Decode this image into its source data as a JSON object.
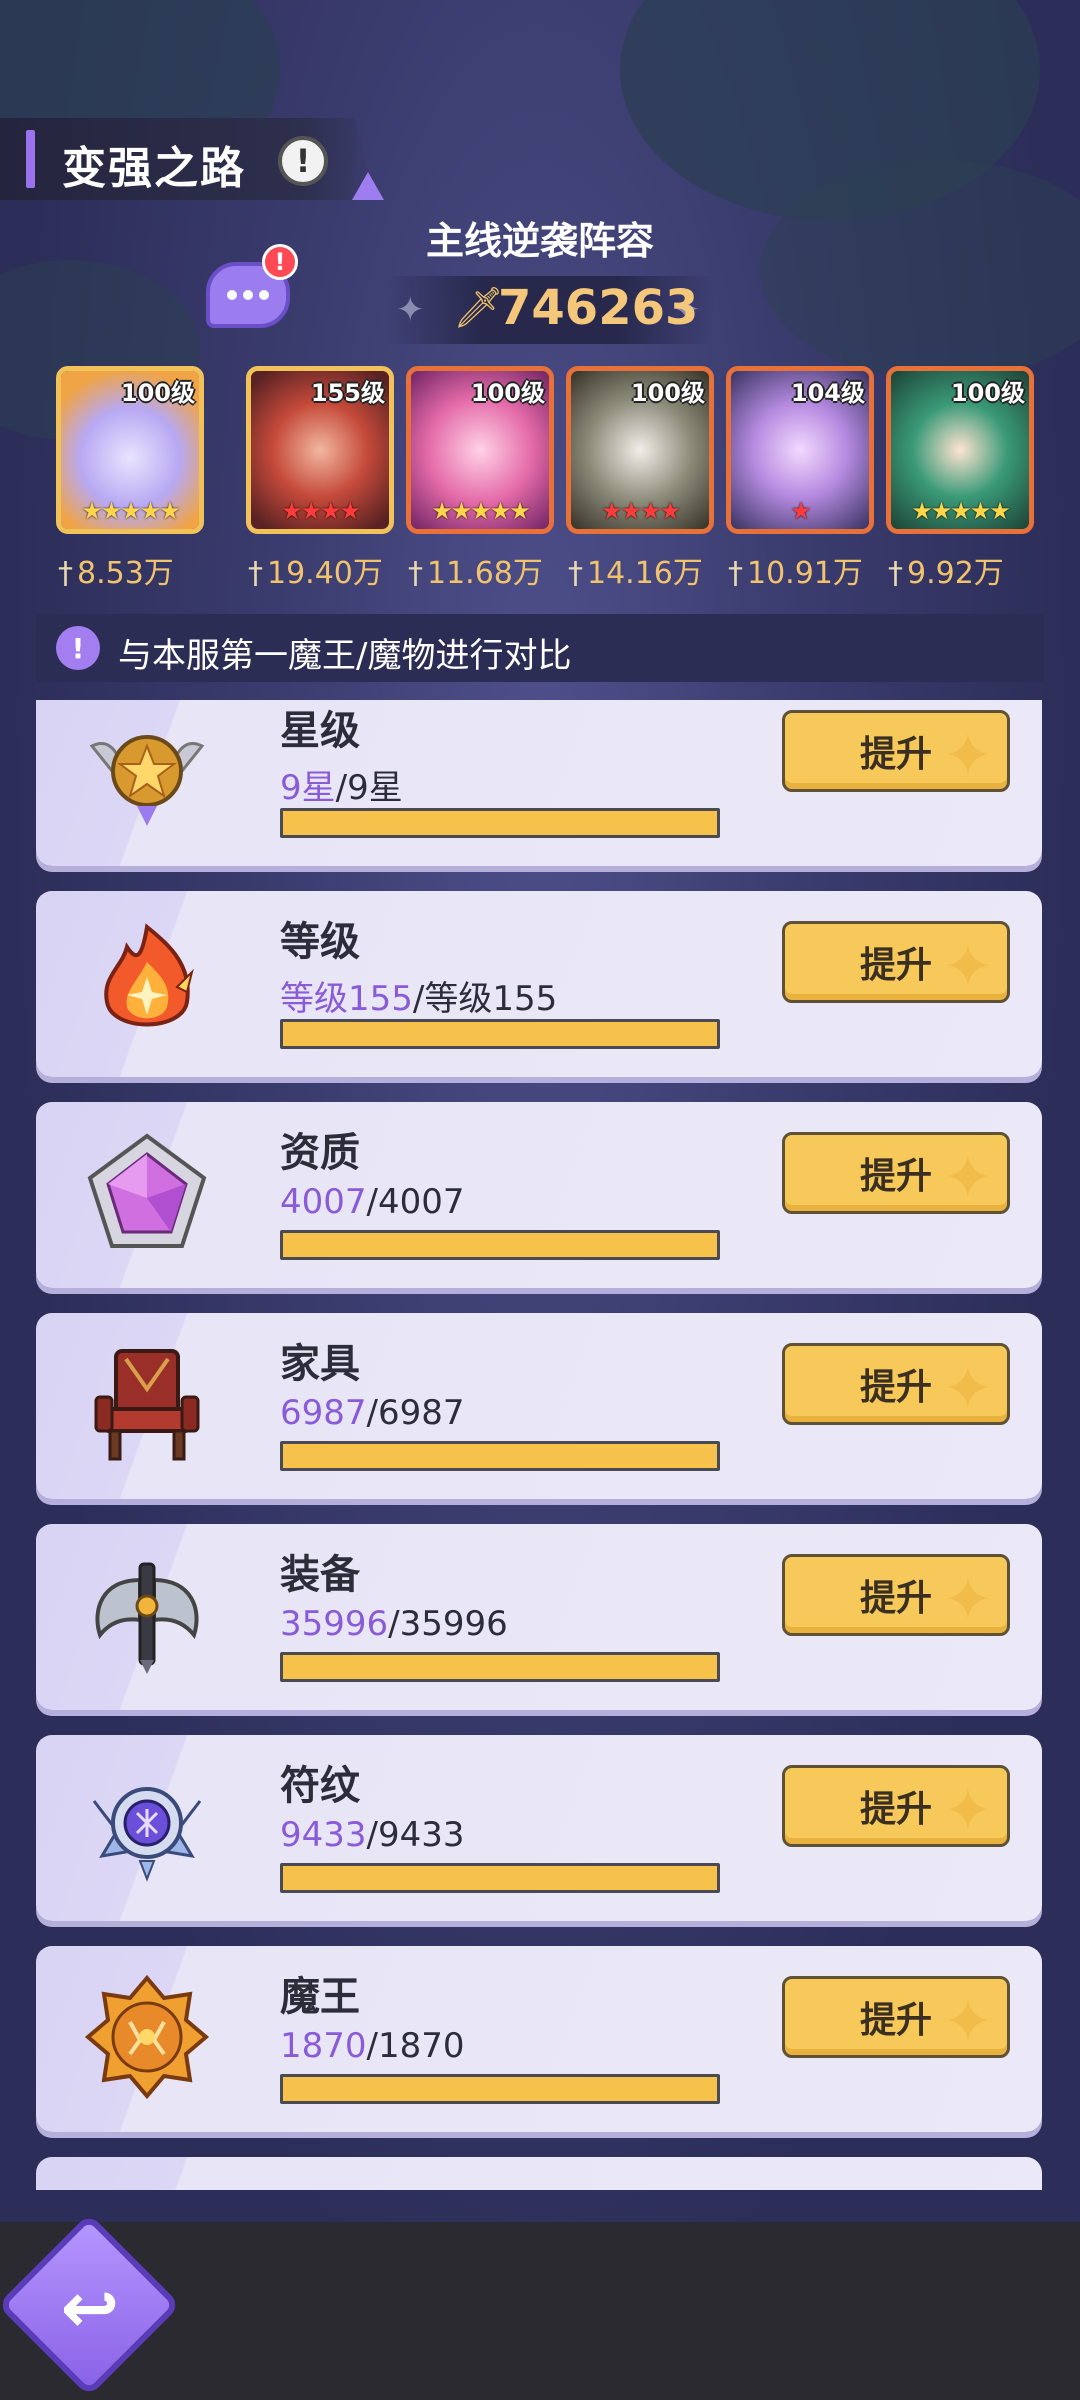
{
  "header": {
    "title": "变强之路",
    "info_glyph": "!",
    "lineup_title": "主线逆袭阵容",
    "total_power": "746263"
  },
  "heroes": [
    {
      "level": "100级",
      "power": "8.53万",
      "stars": "★★★★★",
      "star_color": "gold"
    },
    {
      "level": "155级",
      "power": "19.40万",
      "stars": "★★★★",
      "star_color": "red"
    },
    {
      "level": "100级",
      "power": "11.68万",
      "stars": "★★★★★",
      "star_color": "gold"
    },
    {
      "level": "100级",
      "power": "14.16万",
      "stars": "★★★★",
      "star_color": "red"
    },
    {
      "level": "104级",
      "power": "10.91万",
      "stars": "★",
      "star_color": "red"
    },
    {
      "level": "100级",
      "power": "9.92万",
      "stars": "★★★★★",
      "star_color": "gold"
    }
  ],
  "compare": {
    "icon_glyph": "!",
    "text": "与本服第一魔王/魔物进行对比"
  },
  "items": [
    {
      "name": "星级",
      "current": "9星",
      "max": "9星",
      "progress": 1.0,
      "button": "提升",
      "icon": "star-badge-icon"
    },
    {
      "name": "等级",
      "current": "等级155",
      "max": "等级155",
      "progress": 1.0,
      "button": "提升",
      "icon": "flame-level-icon"
    },
    {
      "name": "资质",
      "current": "4007",
      "max": "4007",
      "progress": 1.0,
      "button": "提升",
      "icon": "pentagon-gem-icon"
    },
    {
      "name": "家具",
      "current": "6987",
      "max": "6987",
      "progress": 1.0,
      "button": "提升",
      "icon": "throne-chair-icon"
    },
    {
      "name": "装备",
      "current": "35996",
      "max": "35996",
      "progress": 1.0,
      "button": "提升",
      "icon": "axe-weapon-icon"
    },
    {
      "name": "符纹",
      "current": "9433",
      "max": "9433",
      "progress": 1.0,
      "button": "提升",
      "icon": "rune-emblem-icon"
    },
    {
      "name": "魔王",
      "current": "1870",
      "max": "1870",
      "progress": 1.0,
      "button": "提升",
      "icon": "demon-king-icon"
    }
  ],
  "colors": {
    "accent": "#9a72ee",
    "button": "#f7c95a",
    "progress_fill": "#f6c24c",
    "current_value": "#8a5bd8",
    "power_text": "#f4c77a"
  }
}
